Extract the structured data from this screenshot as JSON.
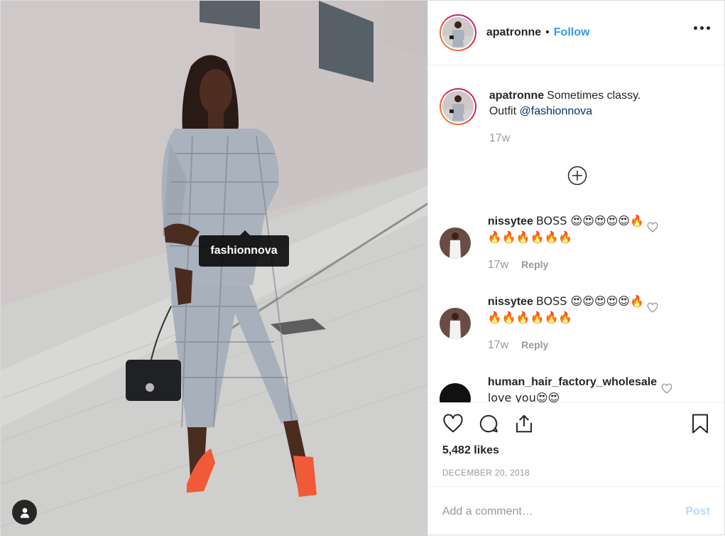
{
  "post": {
    "tag_label": "fashionnova"
  },
  "header": {
    "username": "apatronne",
    "separator": "•",
    "follow_label": "Follow"
  },
  "caption": {
    "username": "apatronne",
    "text_line1": "Sometimes classy.",
    "text_line2": "Outfit",
    "mention": "@fashionnova",
    "time": "17w"
  },
  "comments": [
    {
      "username": "nissytee",
      "text_line1": "BOSS 😍😍😍😍😍🔥",
      "text_line2": "🔥🔥🔥🔥🔥🔥",
      "time": "17w",
      "reply_label": "Reply"
    },
    {
      "username": "nissytee",
      "text_line1": "BOSS 😍😍😍😍😍🔥",
      "text_line2": "🔥🔥🔥🔥🔥🔥",
      "time": "17w",
      "reply_label": "Reply"
    },
    {
      "username": "human_hair_factory_wholesale",
      "text_line1": "",
      "text_line2": "love you😍😍"
    }
  ],
  "actions": {
    "likes": "5,482 likes",
    "date": "DECEMBER 20, 2018"
  },
  "comment_input": {
    "placeholder": "Add a comment…",
    "post_label": "Post"
  },
  "icons": {
    "like": "heart-icon",
    "comment": "speech-bubble-icon",
    "share": "share-icon",
    "save": "bookmark-icon",
    "more": "more-options-icon",
    "load_more": "plus-circle-icon",
    "user_tags": "user-tags-icon"
  },
  "colors": {
    "follow": "#3897f0",
    "post_disabled": "#b2dffc",
    "meta": "#999999"
  }
}
